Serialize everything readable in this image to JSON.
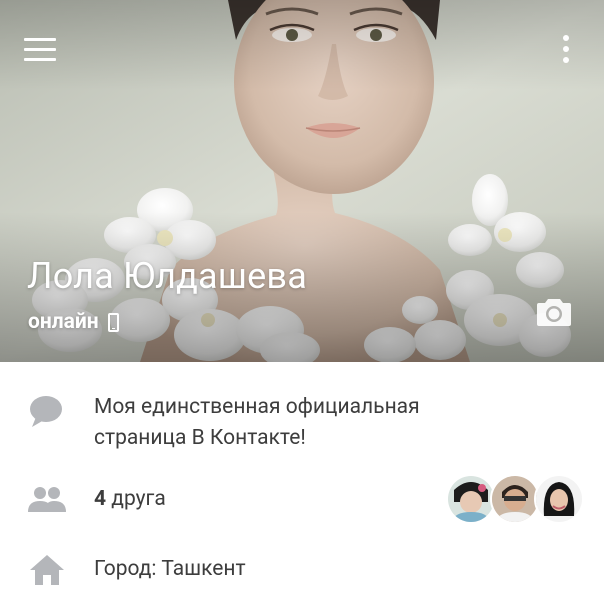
{
  "header": {
    "menu_icon": "hamburger-menu-icon",
    "more_icon": "vertical-dots-icon"
  },
  "profile": {
    "name": "Лола Юлдашева",
    "status": "онлайн",
    "status_device_icon": "mobile-phone-icon",
    "camera_icon": "camera-icon"
  },
  "info": {
    "about": {
      "icon": "speech-bubble-icon",
      "line1": "Моя единственная официальная",
      "line2": "страница В Контакте!"
    },
    "friends": {
      "icon": "people-icon",
      "count": "4",
      "label": " друга"
    },
    "city": {
      "icon": "home-icon",
      "text": "Город: Ташкент"
    }
  },
  "colors": {
    "icon_gray": "#b4b6ba",
    "text_dark": "#3d3d3d",
    "background": "#ffffff"
  }
}
